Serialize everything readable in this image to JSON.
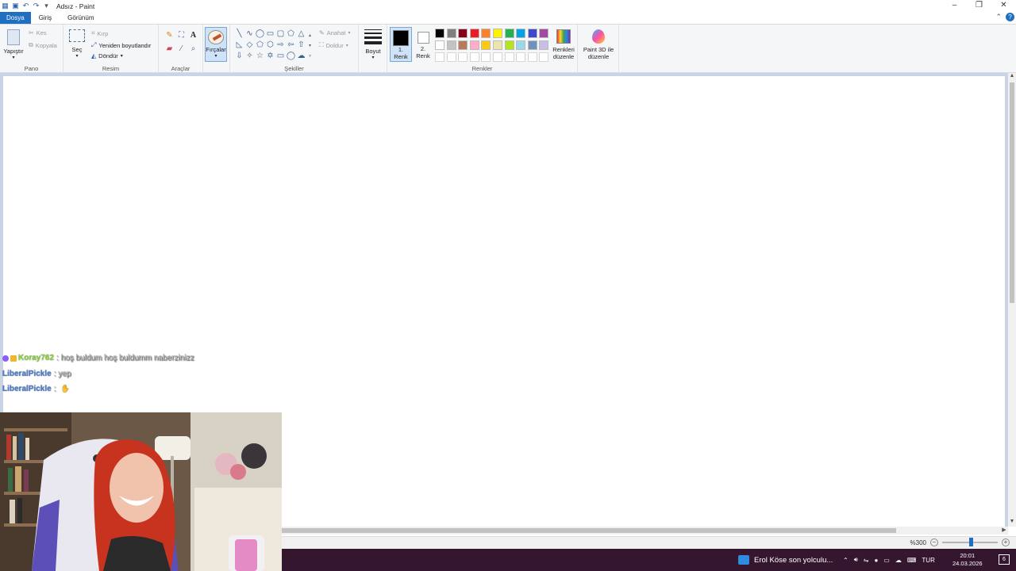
{
  "window": {
    "title": "Adsız - Paint",
    "controls": [
      "–",
      "❐",
      "✕"
    ]
  },
  "tabs": [
    {
      "label": "Dosya"
    },
    {
      "label": "Giriş"
    },
    {
      "label": "Görünüm"
    }
  ],
  "ribbon": {
    "pano": {
      "group_label": "Pano",
      "paste_label": "Yapıştır",
      "cut_label": "Kes",
      "copy_label": "Kopyala"
    },
    "resim": {
      "group_label": "Resim",
      "select_label": "Seç",
      "crop_label": "Kırp",
      "resize_label": "Yeniden boyutlandır",
      "rotate_label": "Döndür"
    },
    "araclar": {
      "group_label": "Araçlar",
      "brushes_label": "Fırçalar"
    },
    "sekiller": {
      "group_label": "Şekiller",
      "outline_label": "Anahat",
      "fill_label": "Doldur"
    },
    "boyut": {
      "size_label": "Boyut"
    },
    "renkler": {
      "group_label": "Renkler",
      "color1_label_a": "1.",
      "color1_label_b": "Renk",
      "color2_label_a": "2.",
      "color2_label_b": "Renk",
      "color1": "#000000",
      "color2": "#ffffff",
      "edit_colors_label_a": "Renkleri",
      "edit_colors_label_b": "düzenle",
      "palette_row1": [
        "#000000",
        "#7f7f7f",
        "#880015",
        "#ed1c24",
        "#ff7f27",
        "#fff200",
        "#22b14c",
        "#00a2e8",
        "#3f48cc",
        "#a349a4"
      ],
      "palette_row2": [
        "#ffffff",
        "#c3c3c3",
        "#b97a57",
        "#ffaec9",
        "#ffc90e",
        "#efe4b0",
        "#b5e61d",
        "#99d9ea",
        "#7092be",
        "#c8bfe7"
      ]
    },
    "paint3d": {
      "label_a": "Paint 3D ile",
      "label_b": "düzenle"
    }
  },
  "chat": [
    {
      "user": "Koray762",
      "message": ": hoş buldum hoş buldumm naberzinizz",
      "user_color": "#8bd63a"
    },
    {
      "user": "LiberalPickle",
      "message": ": yep",
      "user_color": "#4a7fd0"
    },
    {
      "user": "LiberalPickle",
      "message": ":",
      "user_color": "#4a7fd0"
    }
  ],
  "status": {
    "zoom_label": "%300",
    "zoom_fraction": 0.52
  },
  "taskbar": {
    "active_app": "Erol Köse son yolculu...",
    "lang": "TUR",
    "time": "20:01",
    "date": "24.03.2026",
    "notifications": "6"
  }
}
